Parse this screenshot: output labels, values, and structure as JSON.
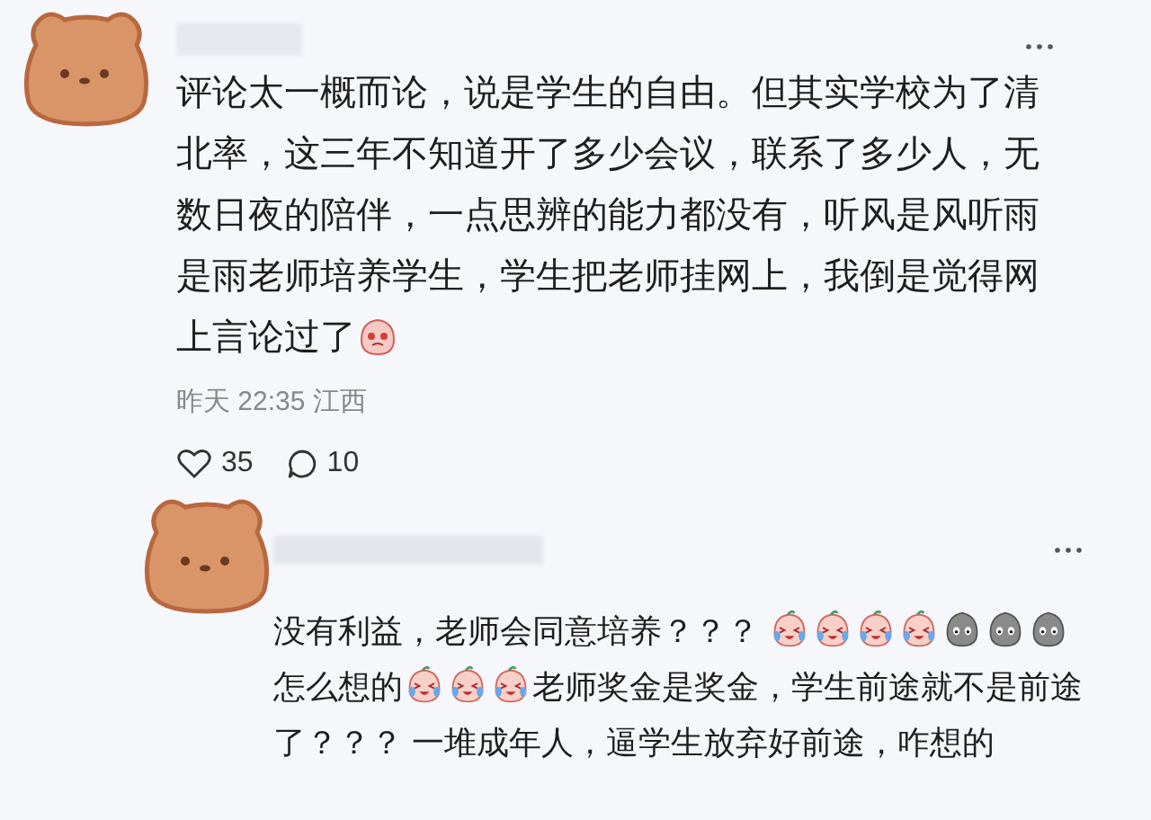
{
  "comments": [
    {
      "segments": [
        {
          "kind": "text",
          "text": "评论太一概而论，说是学生的自由。但其实学校为了清北率，这三年不知道开了多少会议，联系了多少人，无数日夜的陪伴，一点思辨的能力都没有，听风是风听雨是雨老师培养学生，学生把老师挂网上，我倒是觉得网上言论过了"
        },
        {
          "kind": "blush"
        }
      ],
      "meta": "昨天 22:35 江西",
      "likes": "35",
      "replies": "10"
    },
    {
      "segments": [
        {
          "kind": "text",
          "text": "没有利益，老师会同意培养？？？ "
        },
        {
          "kind": "laugh-cry"
        },
        {
          "kind": "laugh-cry"
        },
        {
          "kind": "laugh-cry"
        },
        {
          "kind": "laugh-cry"
        },
        {
          "kind": "grey-face"
        },
        {
          "kind": "grey-face"
        },
        {
          "kind": "grey-face"
        },
        {
          "kind": "text",
          "text": "怎么想的"
        },
        {
          "kind": "laugh-cry"
        },
        {
          "kind": "laugh-cry"
        },
        {
          "kind": "laugh-cry"
        },
        {
          "kind": "text",
          "text": "老师奖金是奖金，学生前途就不是前途了？？？ 一堆成年人，逼学生放弃好前途，咋想的"
        }
      ]
    }
  ]
}
